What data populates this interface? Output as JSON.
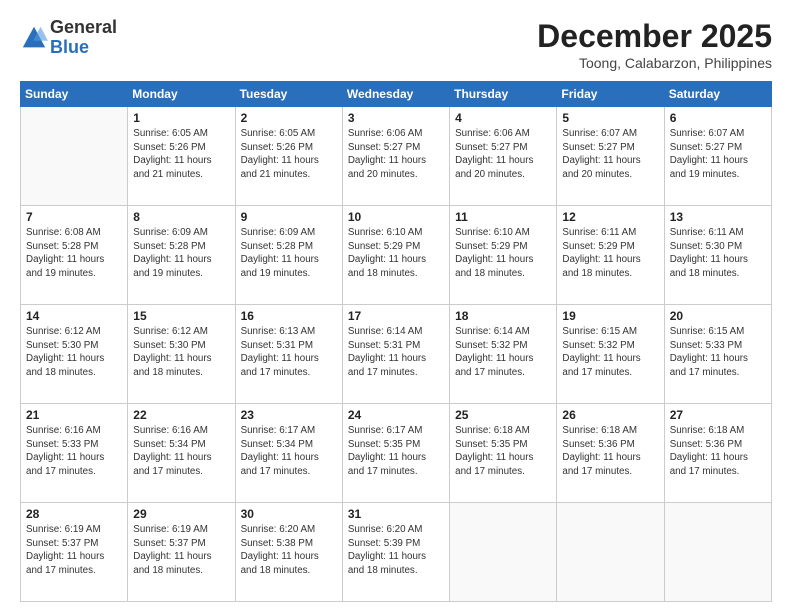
{
  "logo": {
    "general": "General",
    "blue": "Blue"
  },
  "title": "December 2025",
  "location": "Toong, Calabarzon, Philippines",
  "days_of_week": [
    "Sunday",
    "Monday",
    "Tuesday",
    "Wednesday",
    "Thursday",
    "Friday",
    "Saturday"
  ],
  "weeks": [
    [
      {
        "day": "",
        "info": ""
      },
      {
        "day": "1",
        "info": "Sunrise: 6:05 AM\nSunset: 5:26 PM\nDaylight: 11 hours\nand 21 minutes."
      },
      {
        "day": "2",
        "info": "Sunrise: 6:05 AM\nSunset: 5:26 PM\nDaylight: 11 hours\nand 21 minutes."
      },
      {
        "day": "3",
        "info": "Sunrise: 6:06 AM\nSunset: 5:27 PM\nDaylight: 11 hours\nand 20 minutes."
      },
      {
        "day": "4",
        "info": "Sunrise: 6:06 AM\nSunset: 5:27 PM\nDaylight: 11 hours\nand 20 minutes."
      },
      {
        "day": "5",
        "info": "Sunrise: 6:07 AM\nSunset: 5:27 PM\nDaylight: 11 hours\nand 20 minutes."
      },
      {
        "day": "6",
        "info": "Sunrise: 6:07 AM\nSunset: 5:27 PM\nDaylight: 11 hours\nand 19 minutes."
      }
    ],
    [
      {
        "day": "7",
        "info": "Sunrise: 6:08 AM\nSunset: 5:28 PM\nDaylight: 11 hours\nand 19 minutes."
      },
      {
        "day": "8",
        "info": "Sunrise: 6:09 AM\nSunset: 5:28 PM\nDaylight: 11 hours\nand 19 minutes."
      },
      {
        "day": "9",
        "info": "Sunrise: 6:09 AM\nSunset: 5:28 PM\nDaylight: 11 hours\nand 19 minutes."
      },
      {
        "day": "10",
        "info": "Sunrise: 6:10 AM\nSunset: 5:29 PM\nDaylight: 11 hours\nand 18 minutes."
      },
      {
        "day": "11",
        "info": "Sunrise: 6:10 AM\nSunset: 5:29 PM\nDaylight: 11 hours\nand 18 minutes."
      },
      {
        "day": "12",
        "info": "Sunrise: 6:11 AM\nSunset: 5:29 PM\nDaylight: 11 hours\nand 18 minutes."
      },
      {
        "day": "13",
        "info": "Sunrise: 6:11 AM\nSunset: 5:30 PM\nDaylight: 11 hours\nand 18 minutes."
      }
    ],
    [
      {
        "day": "14",
        "info": "Sunrise: 6:12 AM\nSunset: 5:30 PM\nDaylight: 11 hours\nand 18 minutes."
      },
      {
        "day": "15",
        "info": "Sunrise: 6:12 AM\nSunset: 5:30 PM\nDaylight: 11 hours\nand 18 minutes."
      },
      {
        "day": "16",
        "info": "Sunrise: 6:13 AM\nSunset: 5:31 PM\nDaylight: 11 hours\nand 17 minutes."
      },
      {
        "day": "17",
        "info": "Sunrise: 6:14 AM\nSunset: 5:31 PM\nDaylight: 11 hours\nand 17 minutes."
      },
      {
        "day": "18",
        "info": "Sunrise: 6:14 AM\nSunset: 5:32 PM\nDaylight: 11 hours\nand 17 minutes."
      },
      {
        "day": "19",
        "info": "Sunrise: 6:15 AM\nSunset: 5:32 PM\nDaylight: 11 hours\nand 17 minutes."
      },
      {
        "day": "20",
        "info": "Sunrise: 6:15 AM\nSunset: 5:33 PM\nDaylight: 11 hours\nand 17 minutes."
      }
    ],
    [
      {
        "day": "21",
        "info": "Sunrise: 6:16 AM\nSunset: 5:33 PM\nDaylight: 11 hours\nand 17 minutes."
      },
      {
        "day": "22",
        "info": "Sunrise: 6:16 AM\nSunset: 5:34 PM\nDaylight: 11 hours\nand 17 minutes."
      },
      {
        "day": "23",
        "info": "Sunrise: 6:17 AM\nSunset: 5:34 PM\nDaylight: 11 hours\nand 17 minutes."
      },
      {
        "day": "24",
        "info": "Sunrise: 6:17 AM\nSunset: 5:35 PM\nDaylight: 11 hours\nand 17 minutes."
      },
      {
        "day": "25",
        "info": "Sunrise: 6:18 AM\nSunset: 5:35 PM\nDaylight: 11 hours\nand 17 minutes."
      },
      {
        "day": "26",
        "info": "Sunrise: 6:18 AM\nSunset: 5:36 PM\nDaylight: 11 hours\nand 17 minutes."
      },
      {
        "day": "27",
        "info": "Sunrise: 6:18 AM\nSunset: 5:36 PM\nDaylight: 11 hours\nand 17 minutes."
      }
    ],
    [
      {
        "day": "28",
        "info": "Sunrise: 6:19 AM\nSunset: 5:37 PM\nDaylight: 11 hours\nand 17 minutes."
      },
      {
        "day": "29",
        "info": "Sunrise: 6:19 AM\nSunset: 5:37 PM\nDaylight: 11 hours\nand 18 minutes."
      },
      {
        "day": "30",
        "info": "Sunrise: 6:20 AM\nSunset: 5:38 PM\nDaylight: 11 hours\nand 18 minutes."
      },
      {
        "day": "31",
        "info": "Sunrise: 6:20 AM\nSunset: 5:39 PM\nDaylight: 11 hours\nand 18 minutes."
      },
      {
        "day": "",
        "info": ""
      },
      {
        "day": "",
        "info": ""
      },
      {
        "day": "",
        "info": ""
      }
    ]
  ]
}
